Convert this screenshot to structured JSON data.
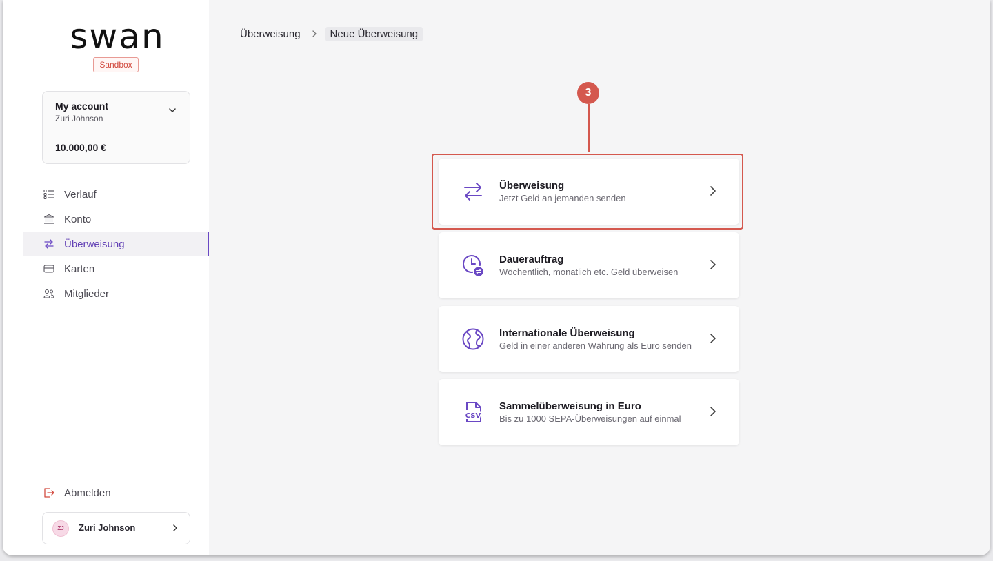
{
  "brand": {
    "logo_text": "swan",
    "environment_badge": "Sandbox"
  },
  "account": {
    "name": "My account",
    "holder": "Zuri Johnson",
    "balance": "10.000,00 €"
  },
  "nav": {
    "items": [
      {
        "label": "Verlauf",
        "icon": "list-icon"
      },
      {
        "label": "Konto",
        "icon": "bank-icon"
      },
      {
        "label": "Überweisung",
        "icon": "transfer-icon",
        "active": true
      },
      {
        "label": "Karten",
        "icon": "card-icon"
      },
      {
        "label": "Mitglieder",
        "icon": "members-icon"
      }
    ]
  },
  "logout_label": "Abmelden",
  "user": {
    "initials": "ZJ",
    "name": "Zuri Johnson"
  },
  "breadcrumb": {
    "parent": "Überweisung",
    "current": "Neue Überweisung"
  },
  "step_marker": "3",
  "options": [
    {
      "title": "Überweisung",
      "subtitle": "Jetzt Geld an jemanden senden",
      "icon": "transfer-arrows-icon"
    },
    {
      "title": "Dauerauftrag",
      "subtitle": "Wöchentlich, monatlich etc. Geld überweisen",
      "icon": "clock-transfer-icon"
    },
    {
      "title": "Internationale Überweisung",
      "subtitle": "Geld in einer anderen Währung als Euro senden",
      "icon": "globe-icon"
    },
    {
      "title": "Sammelüberweisung in Euro",
      "subtitle": "Bis zu 1000 SEPA-Überweisungen auf einmal",
      "icon": "csv-file-icon"
    }
  ],
  "colors": {
    "accent": "#6a48c4",
    "highlight": "#d4584e",
    "danger": "#d24a3f"
  }
}
